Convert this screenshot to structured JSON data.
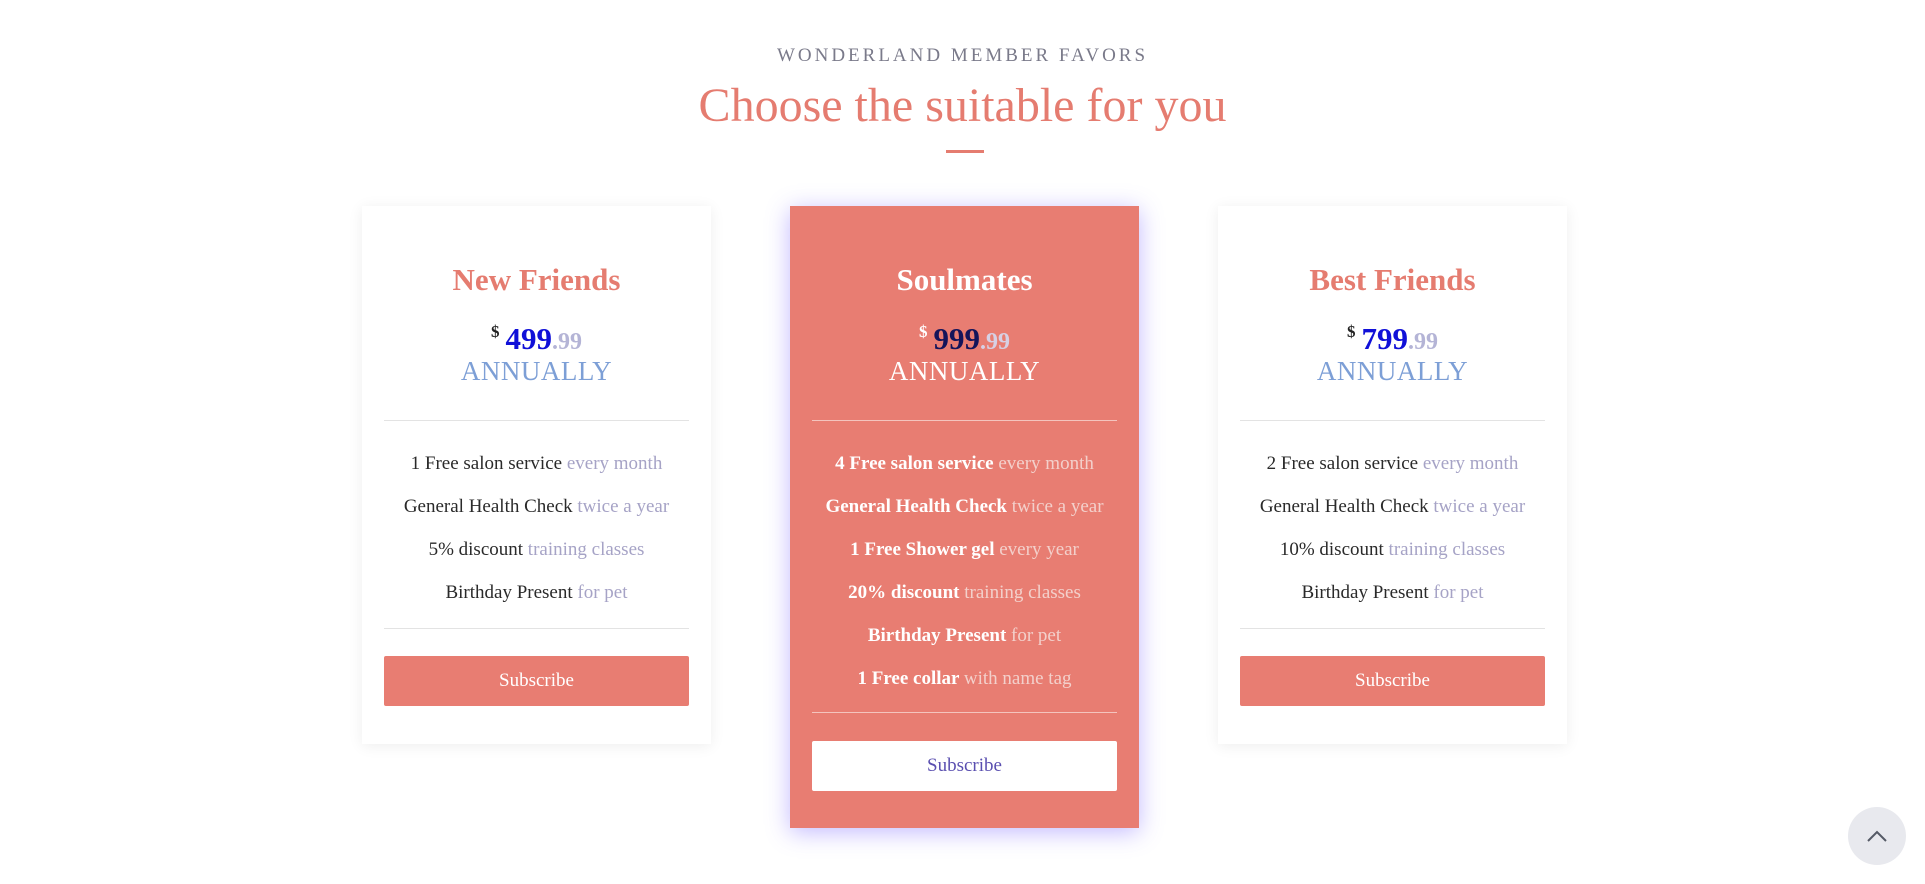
{
  "header": {
    "eyebrow": "WONDERLAND MEMBER FAVORS",
    "headline": "Choose the suitable for you"
  },
  "plans": [
    {
      "name": "New Friends",
      "currency": "$",
      "price_int": "499",
      "price_dec": ".99",
      "period": "ANNUALLY",
      "features": [
        {
          "main": "1 Free salon service",
          "soft": "every month"
        },
        {
          "main": "General Health Check",
          "soft": "twice a year"
        },
        {
          "main": "5% discount",
          "soft": "training classes"
        },
        {
          "main": "Birthday Present",
          "soft": "for pet"
        }
      ],
      "button": "Subscribe"
    },
    {
      "name": "Soulmates",
      "currency": "$",
      "price_int": "999",
      "price_dec": ".99",
      "period": "ANNUALLY",
      "features": [
        {
          "main": "4 Free salon service",
          "soft": "every month"
        },
        {
          "main": "General Health Check",
          "soft": "twice a year"
        },
        {
          "main": "1 Free Shower gel",
          "soft": "every year"
        },
        {
          "main": "20% discount",
          "soft": "training classes"
        },
        {
          "main": "Birthday Present",
          "soft": "for pet"
        },
        {
          "main": "1 Free collar",
          "soft": "with name tag"
        }
      ],
      "button": "Subscribe"
    },
    {
      "name": "Best Friends",
      "currency": "$",
      "price_int": "799",
      "price_dec": ".99",
      "period": "ANNUALLY",
      "features": [
        {
          "main": "2 Free salon service",
          "soft": "every month"
        },
        {
          "main": "General Health Check",
          "soft": "twice a year"
        },
        {
          "main": "10% discount",
          "soft": "training classes"
        },
        {
          "main": "Birthday Present",
          "soft": "for pet"
        }
      ],
      "button": "Subscribe"
    }
  ],
  "icons": {
    "scroll_top": "chevron-up-icon"
  },
  "colors": {
    "accent": "#e87d72",
    "price": "#1010d8",
    "period": "#7d9fd6",
    "muted": "#a6a3c6",
    "featured_glow": "#7864ff"
  }
}
